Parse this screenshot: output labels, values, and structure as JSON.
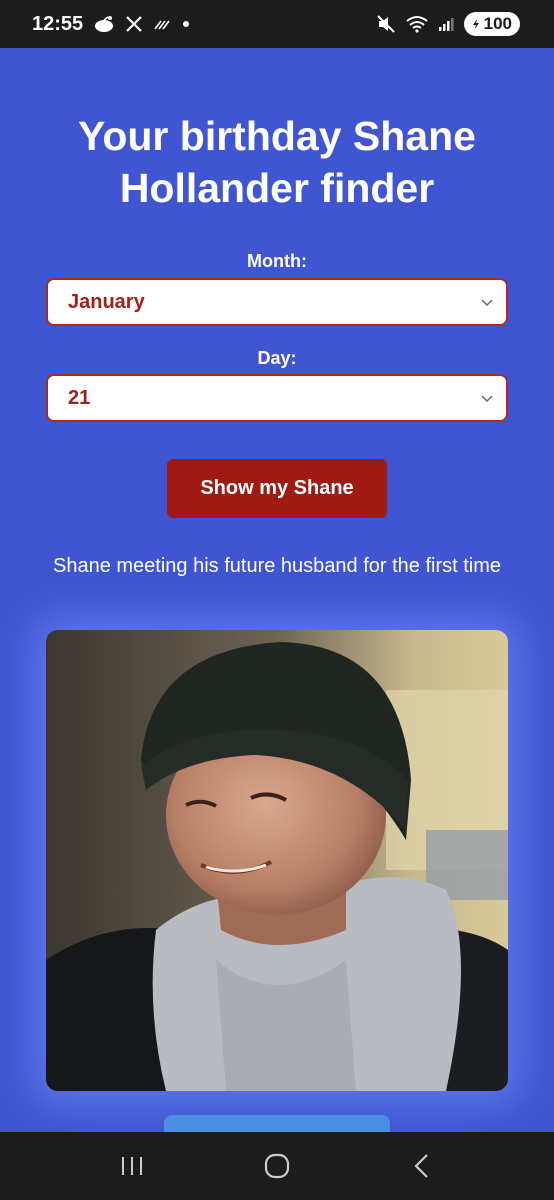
{
  "status_bar": {
    "time": "12:55",
    "battery": "100",
    "left_icons": [
      "reddit-icon",
      "x-icon",
      "data-icon",
      "dot-icon"
    ],
    "right_icons": [
      "mute-icon",
      "wifi-icon",
      "signal-icon",
      "battery-icon"
    ]
  },
  "page": {
    "title": "Your birthday Shane Hollander finder",
    "month_label": "Month:",
    "month_value": "January",
    "day_label": "Day:",
    "day_value": "21",
    "button_label": "Show my Shane",
    "caption": "Shane meeting his future husband for the first time"
  },
  "colors": {
    "background": "#3f55d1",
    "accent": "#9e1a12",
    "select_text": "#a3201a",
    "partial_button": "#4a90e2"
  },
  "nav_bar": {
    "icons": [
      "recents-icon",
      "home-icon",
      "back-icon"
    ]
  }
}
